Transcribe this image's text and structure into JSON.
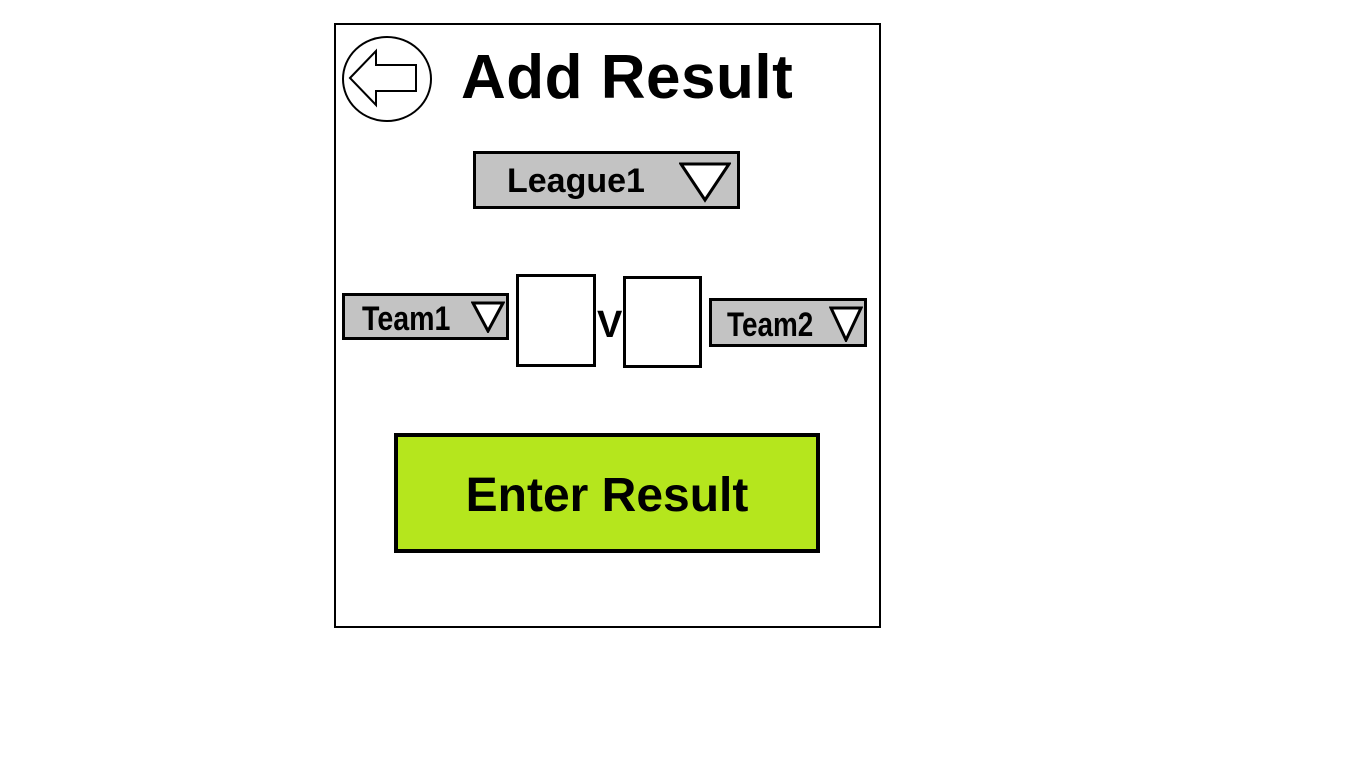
{
  "page": {
    "title": "Add Result"
  },
  "league_select": {
    "selected": "League1"
  },
  "match": {
    "home_team": "Team1",
    "away_team": "Team2",
    "versus": "V",
    "home_score": "",
    "away_score": ""
  },
  "actions": {
    "enter_result_label": "Enter Result"
  },
  "icons": {
    "back": "arrow-left-circle-icon",
    "dropdown": "triangle-down-icon"
  },
  "colors": {
    "dropdown_background": "#c3c3c3",
    "enter_button_background": "#b5e61d",
    "border": "#000000",
    "background": "#ffffff"
  }
}
